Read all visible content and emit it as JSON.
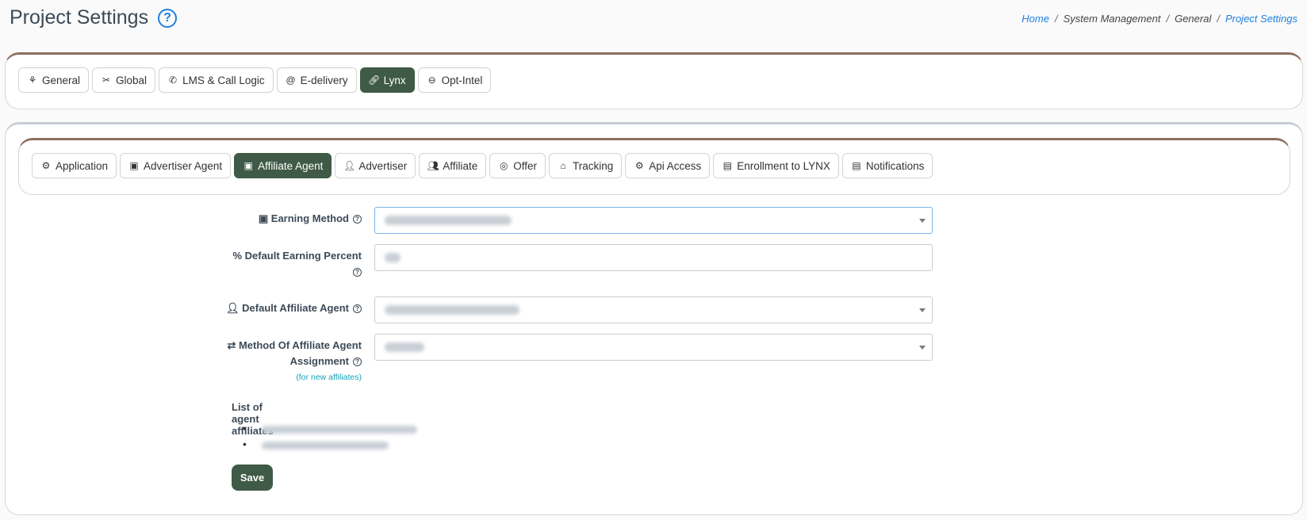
{
  "header": {
    "title": "Project Settings",
    "help_icon": "help-circle-icon",
    "breadcrumb": [
      "Home",
      "System Management",
      "General",
      "Project Settings"
    ]
  },
  "top_tabs": [
    {
      "label": "General",
      "icon": "cluster-icon",
      "active": false
    },
    {
      "label": "Global",
      "icon": "tools-icon",
      "active": false
    },
    {
      "label": "LMS & Call Logic",
      "icon": "phone-icon",
      "active": false
    },
    {
      "label": "E-delivery",
      "icon": "at-icon",
      "active": false
    },
    {
      "label": "Lynx",
      "icon": "link-icon",
      "active": true
    },
    {
      "label": "Opt-Intel",
      "icon": "minus-circle-icon",
      "active": false
    }
  ],
  "sub_tabs": [
    {
      "label": "Application",
      "icon": "gear-icon",
      "active": false
    },
    {
      "label": "Advertiser Agent",
      "icon": "money-icon",
      "active": false
    },
    {
      "label": "Affiliate Agent",
      "icon": "money-icon",
      "active": true
    },
    {
      "label": "Advertiser",
      "icon": "user-tie-icon",
      "active": false
    },
    {
      "label": "Affiliate",
      "icon": "users-gear-icon",
      "active": false
    },
    {
      "label": "Offer",
      "icon": "globe-icon",
      "active": false
    },
    {
      "label": "Tracking",
      "icon": "tag-icon",
      "active": false
    },
    {
      "label": "Api Access",
      "icon": "gear-icon",
      "active": false
    },
    {
      "label": "Enrollment to LYNX",
      "icon": "document-icon",
      "active": false
    },
    {
      "label": "Notifications",
      "icon": "document-icon",
      "active": false
    }
  ],
  "form": {
    "earning_method_label": "Earning Method",
    "default_earning_percent_label": "Default Earning Percent",
    "default_affiliate_agent_label": "Default Affiliate Agent",
    "method_assignment_label": "Method Of Affiliate Agent Assignment",
    "method_assignment_note": "(for new affiliates)"
  },
  "agent_affiliates": {
    "title": "List of agent affiliates"
  },
  "save_label": "Save",
  "colors": {
    "accent": "#3f5a46",
    "link": "#1f7fe0",
    "card_border_top": "#8b6f60",
    "note": "#17a2b8"
  }
}
